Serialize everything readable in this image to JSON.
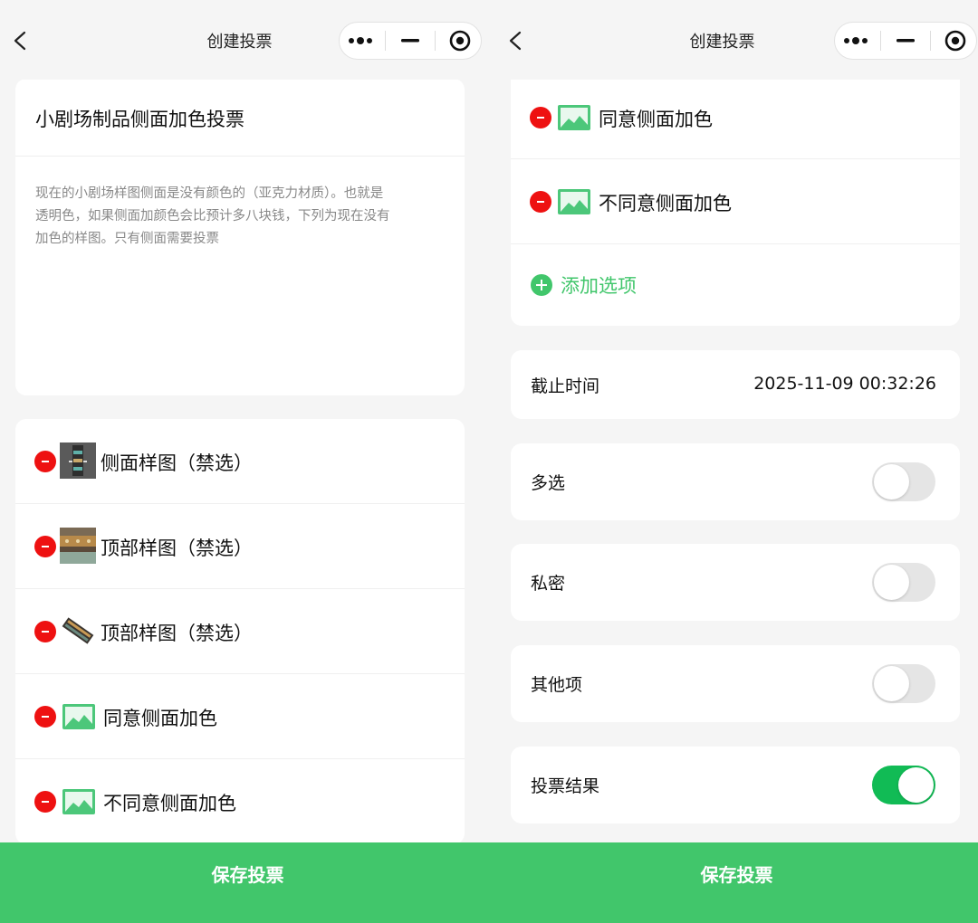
{
  "left": {
    "nav": {
      "title": "创建投票"
    },
    "poll": {
      "title": "小剧场制品侧面加色投票",
      "description": "现在的小剧场样图侧面是没有颜色的（亚克力材质）。也就是透明色，如果侧面加颜色会比预计多八块钱，下列为现在没有加色的样图。只有侧面需要投票"
    },
    "options": [
      {
        "label": "侧面样图（禁选）",
        "image": "photo-thumbnail"
      },
      {
        "label": "顶部样图（禁选）",
        "image": "photo-thumbnail"
      },
      {
        "label": "顶部样图（禁选）",
        "image": "photo-thumbnail"
      },
      {
        "label": "同意侧面加色",
        "image": "image-placeholder-icon"
      },
      {
        "label": "不同意侧面加色",
        "image": "image-placeholder-icon"
      }
    ],
    "save_label": "保存投票"
  },
  "right": {
    "nav": {
      "title": "创建投票"
    },
    "options": [
      {
        "label": "同意侧面加色",
        "image": "image-placeholder-icon"
      },
      {
        "label": "不同意侧面加色",
        "image": "image-placeholder-icon"
      }
    ],
    "add_option_label": "添加选项",
    "deadline": {
      "label": "截止时间",
      "value": "2025-11-09 00:32:26"
    },
    "settings": [
      {
        "label": "多选",
        "on": false
      },
      {
        "label": "私密",
        "on": false
      },
      {
        "label": "其他项",
        "on": false
      },
      {
        "label": "投票结果",
        "on": true
      }
    ],
    "save_label": "保存投票"
  },
  "colors": {
    "accent": "#41c66b",
    "toggle_on": "#11bb55",
    "delete": "#ee1111",
    "background": "#f5f5f5"
  }
}
